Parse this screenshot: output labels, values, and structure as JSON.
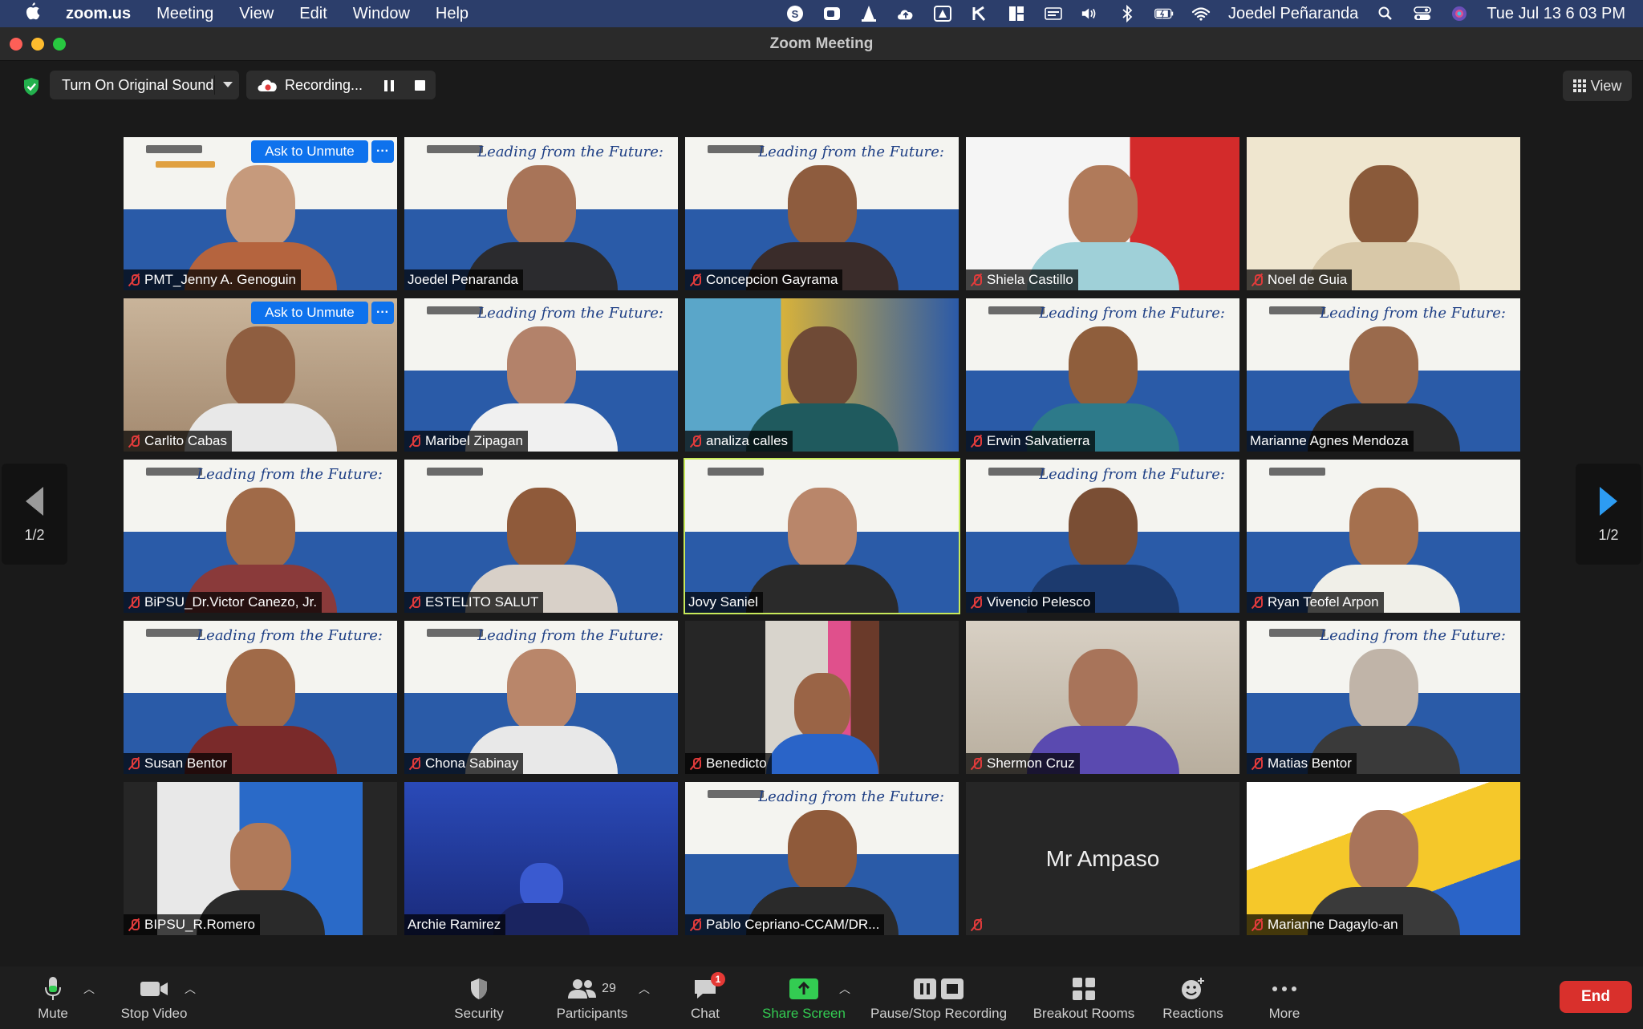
{
  "menubar": {
    "app": "zoom.us",
    "items": [
      "Meeting",
      "View",
      "Edit",
      "Window",
      "Help"
    ],
    "user": "Joedel Peñaranda",
    "clock": "Tue Jul 13  6 03 PM"
  },
  "window": {
    "title": "Zoom Meeting"
  },
  "topbar": {
    "original_sound": "Turn On Original Sound",
    "recording": "Recording...",
    "view": "View"
  },
  "nav": {
    "page": "1/2"
  },
  "tile_actions": {
    "unmute": "Ask to Unmute",
    "more": "···"
  },
  "banner": {
    "title": "Leading from the Future:"
  },
  "participants": [
    {
      "name": "PMT_Jenny A. Genoguin",
      "muted": true
    },
    {
      "name": "Joedel Penaranda",
      "muted": false
    },
    {
      "name": "Concepcion Gayrama",
      "muted": true
    },
    {
      "name": "Shiela Castillo",
      "muted": true
    },
    {
      "name": "Noel de Guia",
      "muted": true
    },
    {
      "name": "Carlito Cabas",
      "muted": true
    },
    {
      "name": "Maribel Zipagan",
      "muted": true
    },
    {
      "name": "analiza calles",
      "muted": true
    },
    {
      "name": "Erwin Salvatierra",
      "muted": true
    },
    {
      "name": "Marianne Agnes Mendoza",
      "muted": false
    },
    {
      "name": "BiPSU_Dr.Victor Canezo, Jr.",
      "muted": true
    },
    {
      "name": "ESTELITO SALUT",
      "muted": true
    },
    {
      "name": "Jovy Saniel",
      "muted": false
    },
    {
      "name": "Vivencio Pelesco",
      "muted": true
    },
    {
      "name": "Ryan Teofel Arpon",
      "muted": true
    },
    {
      "name": "Susan Bentor",
      "muted": true
    },
    {
      "name": "Chona Sabinay",
      "muted": true
    },
    {
      "name": "Benedicto",
      "muted": true
    },
    {
      "name": "Shermon Cruz",
      "muted": true
    },
    {
      "name": "Matias Bentor",
      "muted": true
    },
    {
      "name": "BIPSU_R.Romero",
      "muted": true
    },
    {
      "name": "Archie Ramirez",
      "muted": false
    },
    {
      "name": "Pablo Cepriano-CCAM/DR...",
      "muted": true
    },
    {
      "name": "",
      "muted": true,
      "display_name": "Mr Ampaso"
    },
    {
      "name": "Marianne Dagaylo-an",
      "muted": true
    }
  ],
  "toolbar": {
    "mute": "Mute",
    "stop_video": "Stop Video",
    "security": "Security",
    "participants": "Participants",
    "participant_count": "29",
    "chat": "Chat",
    "chat_badge": "1",
    "share_screen": "Share Screen",
    "recording": "Pause/Stop Recording",
    "breakout": "Breakout Rooms",
    "reactions": "Reactions",
    "more": "More",
    "end": "End"
  },
  "colors": {
    "accent_blue": "#0e72ed",
    "muted_red": "#e03b3b",
    "share_green": "#33cc52",
    "end_red": "#d9302c",
    "active_speaker": "#c7e95a"
  }
}
